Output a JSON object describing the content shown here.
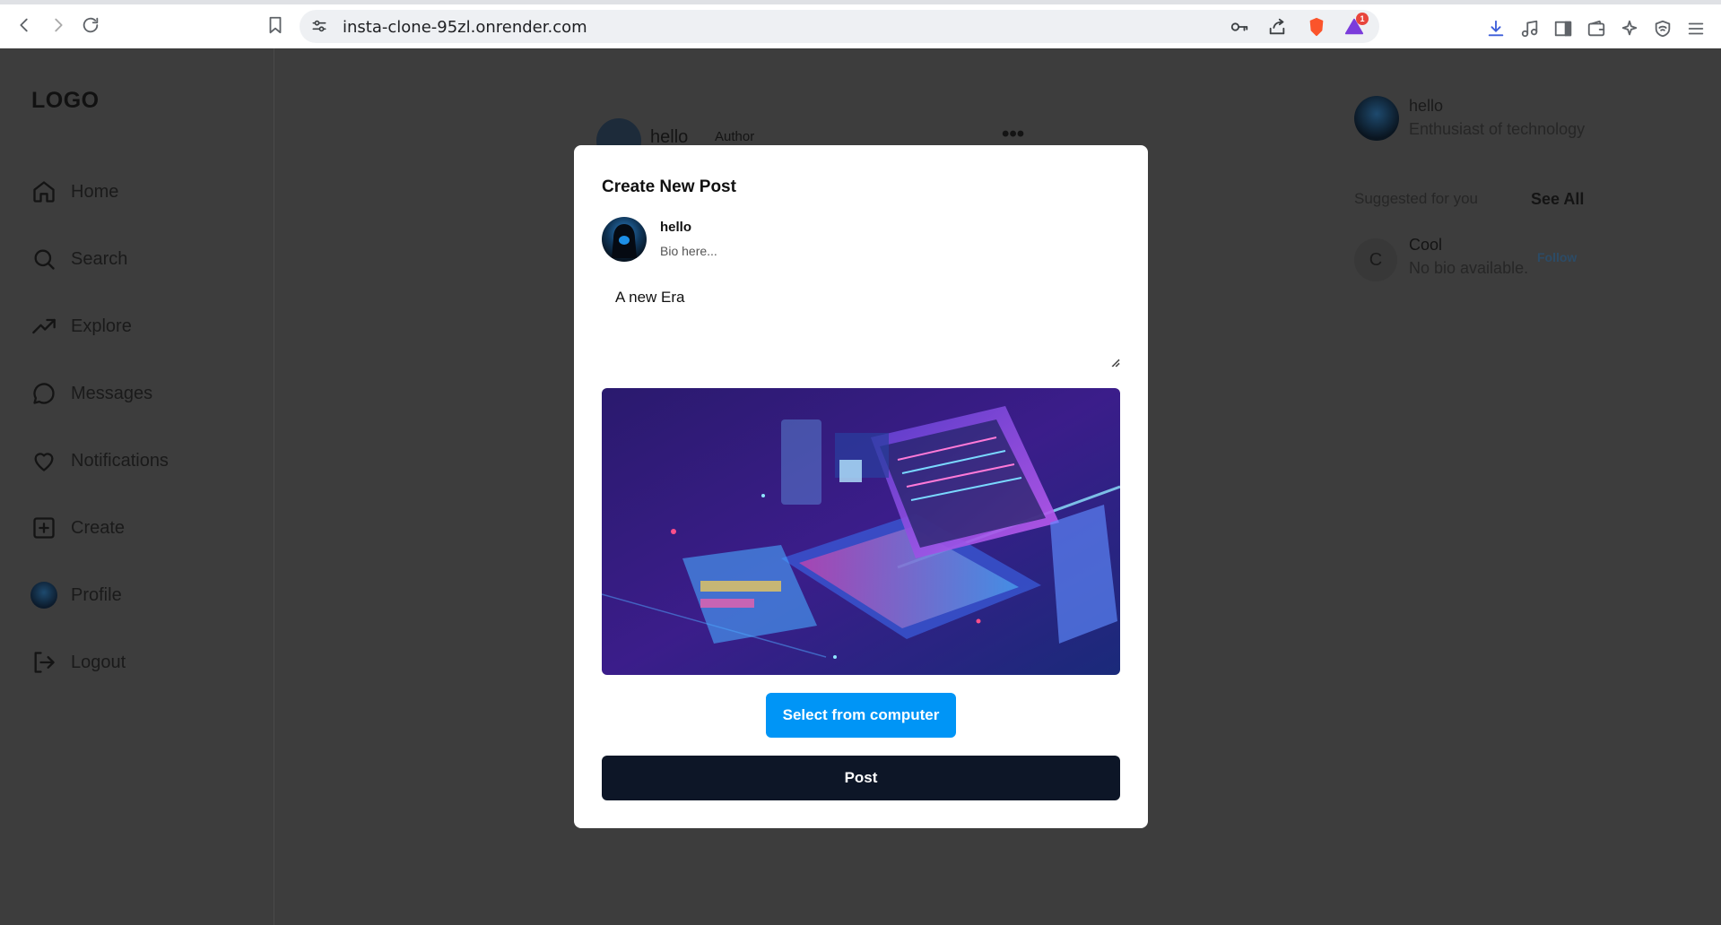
{
  "browser": {
    "url": "insta-clone-95zl.onrender.com",
    "notification_count": "1"
  },
  "sidebar": {
    "logo": "LOGO",
    "items": [
      {
        "label": "Home",
        "icon": "home-icon"
      },
      {
        "label": "Search",
        "icon": "search-icon"
      },
      {
        "label": "Explore",
        "icon": "trending-icon"
      },
      {
        "label": "Messages",
        "icon": "message-icon"
      },
      {
        "label": "Notifications",
        "icon": "heart-icon"
      },
      {
        "label": "Create",
        "icon": "plus-square-icon"
      },
      {
        "label": "Profile",
        "icon": "avatar"
      },
      {
        "label": "Logout",
        "icon": "logout-icon"
      }
    ]
  },
  "feed": {
    "username": "hello",
    "author_label": "Author"
  },
  "right_panel": {
    "username": "hello",
    "bio": "Enthusiast of technology",
    "suggested_heading": "Suggested for you",
    "see_all": "See All",
    "suggestion": {
      "initial": "C",
      "name": "Cool",
      "bio": "No bio available.",
      "follow": "Follow"
    }
  },
  "modal": {
    "title": "Create New Post",
    "username": "hello",
    "bio": "Bio here...",
    "caption": "A new Era",
    "select_button": "Select from computer",
    "post_button": "Post"
  },
  "colors": {
    "overlay_bg": "#3d3d3d",
    "select_button": "#0095f6",
    "post_button": "#0d1627"
  }
}
